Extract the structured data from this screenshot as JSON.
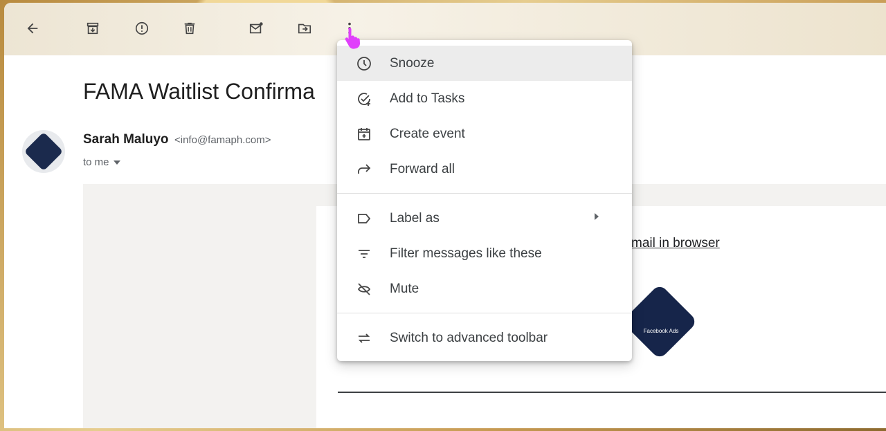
{
  "toolbar": {
    "icons": [
      "back-arrow-icon",
      "archive-icon",
      "report-spam-icon",
      "delete-icon",
      "mark-unread-icon",
      "move-to-icon",
      "more-vert-icon"
    ]
  },
  "email": {
    "subject": "FAMA Waitlist Confirma",
    "sender_name": "Sarah Maluyo",
    "sender_email": "<info@famaph.com>",
    "to_label": "to me",
    "view_in_browser": "mail in browser",
    "logo_text": "Facebook Ads"
  },
  "menu": {
    "items": [
      {
        "label": "Snooze",
        "icon": "clock-icon"
      },
      {
        "label": "Add to Tasks",
        "icon": "add-task-icon"
      },
      {
        "label": "Create event",
        "icon": "calendar-icon"
      },
      {
        "label": "Forward all",
        "icon": "forward-icon"
      },
      {
        "label": "Label as",
        "icon": "label-icon"
      },
      {
        "label": "Filter messages like these",
        "icon": "filter-icon"
      },
      {
        "label": "Mute",
        "icon": "mute-icon"
      },
      {
        "label": "Switch to advanced toolbar",
        "icon": "swap-icon"
      }
    ]
  },
  "colors": {
    "accent_cursor": "#e040fb",
    "logo_navy": "#16254a"
  }
}
